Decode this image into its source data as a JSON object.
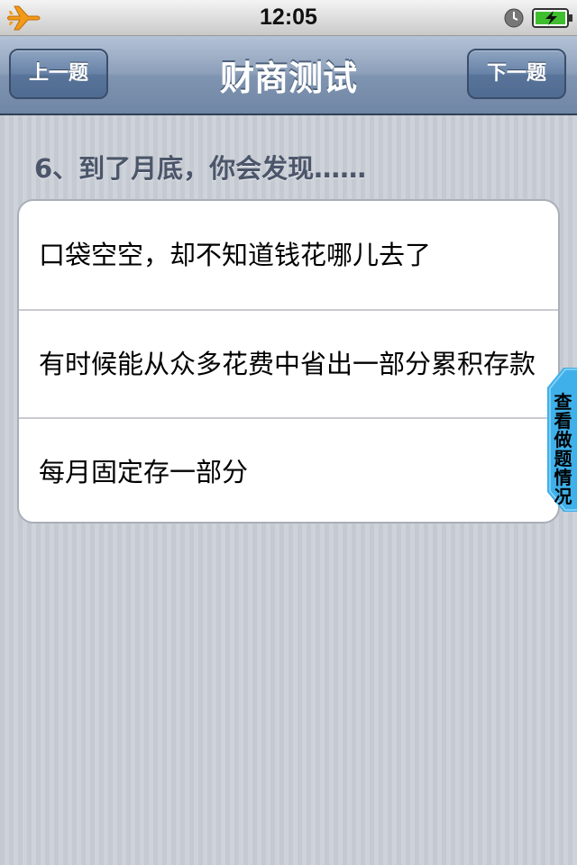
{
  "status_bar": {
    "time": "12:05",
    "icons": [
      "airplane-icon",
      "clock-icon",
      "battery-charging-icon"
    ]
  },
  "nav": {
    "title": "财商测试",
    "prev_label": "上一题",
    "next_label": "下一题"
  },
  "question": {
    "text": "6、到了月底，你会发现……",
    "options": [
      "口袋空空，却不知道钱花哪儿去了",
      "有时候能从众多花费中省出一部分累积存款",
      "每月固定存一部分"
    ]
  },
  "side_tab": {
    "label": "查看做题情况"
  },
  "colors": {
    "nav_bar": "#8da0ba",
    "airplane": "#f29a1a",
    "battery_fill": "#3fbf2f",
    "side_tab": "#3fb0ea"
  }
}
